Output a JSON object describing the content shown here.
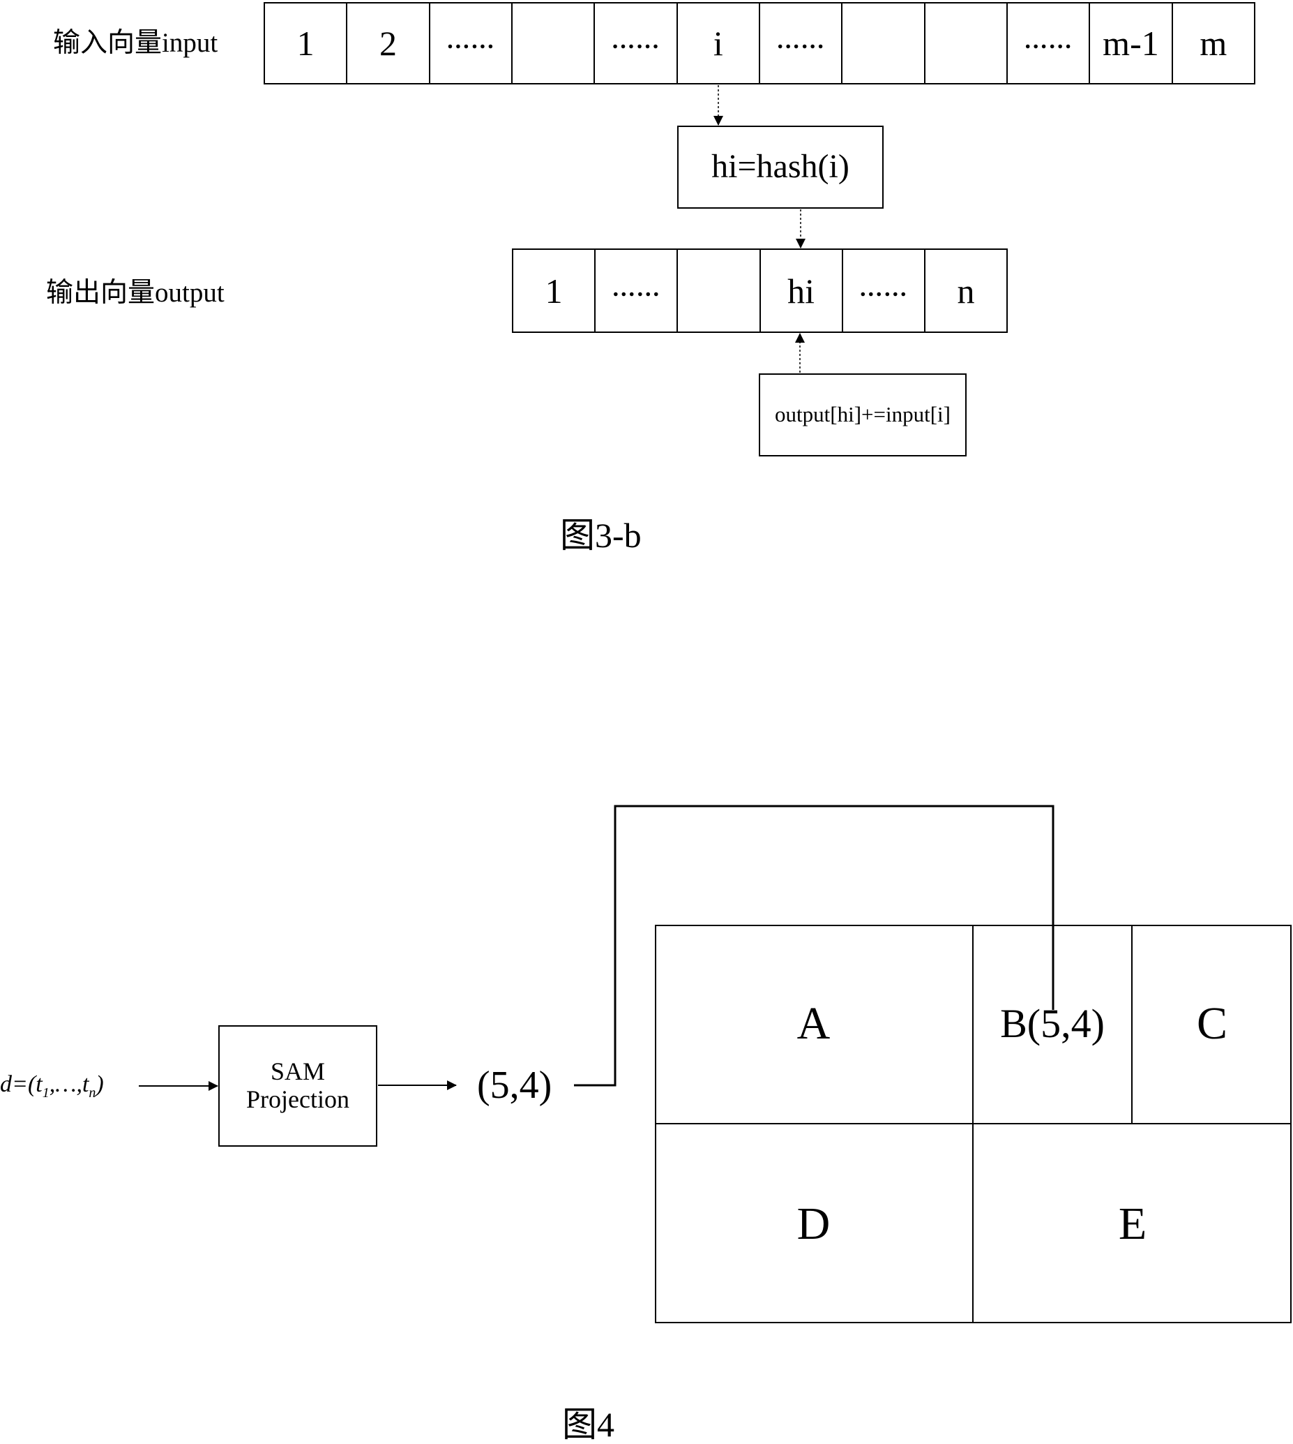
{
  "figure_3b": {
    "input_label": "输入向量input",
    "output_label": "输出向量output",
    "input_cells": [
      "1",
      "2",
      "……",
      "",
      "……",
      "i",
      "……",
      "",
      "",
      "……",
      "m-1",
      "m"
    ],
    "hash_box": "hi=hash(i)",
    "output_cells": [
      "1",
      "……",
      "",
      "hi",
      "……",
      "n"
    ],
    "update_box": "output[hi]+=input[i]",
    "caption": "图3-b"
  },
  "figure_4": {
    "input_expression": {
      "prefix": "d=(t",
      "sub1": "1",
      "middle": ",…,t",
      "subn": "n",
      "suffix": ")"
    },
    "projection_box": {
      "line1": "SAM",
      "line2": "Projection"
    },
    "coordinate": "(5,4)",
    "regions": {
      "A": "A",
      "B": "B(5,4)",
      "C": "C",
      "D": "D",
      "E": "E"
    },
    "caption": "图4"
  }
}
